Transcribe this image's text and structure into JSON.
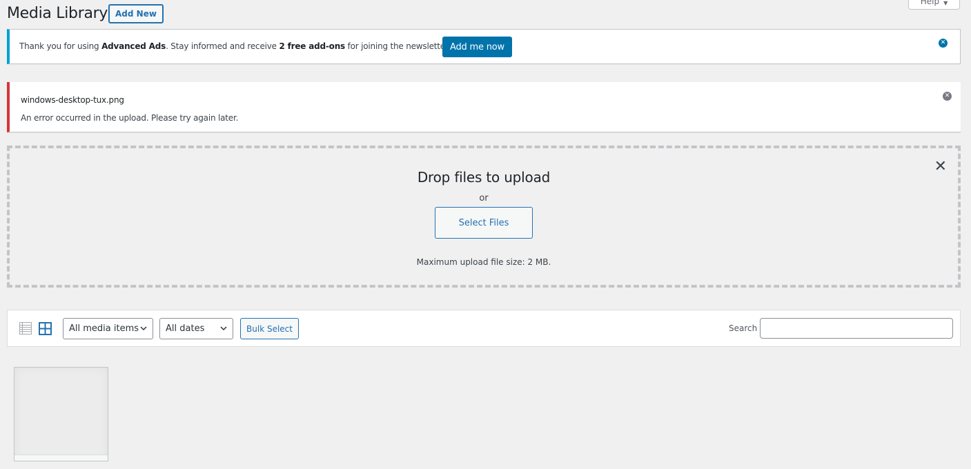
{
  "header": {
    "title": "Media Library",
    "add_new_label": "Add New",
    "help_label": "Help"
  },
  "notice_info": {
    "text_parts": [
      "Thank you for using ",
      "Advanced Ads",
      ". Stay informed and receive ",
      "2 free add-ons",
      " for joining the newsletter."
    ],
    "button_label": "Add me now",
    "accent_color": "#00a0d2"
  },
  "notice_error": {
    "filename": "windows-desktop-tux.png",
    "message": "An error occurred in the upload. Please try again later.",
    "accent_color": "#d63638"
  },
  "uploader": {
    "title": "Drop files to upload",
    "or_label": "or",
    "select_button_label": "Select Files",
    "max_size_text": "Maximum upload file size: 2 MB."
  },
  "toolbar": {
    "view_modes": [
      "list",
      "grid"
    ],
    "active_view": "grid",
    "media_type_filter": "All media items",
    "date_filter": "All dates",
    "bulk_select_label": "Bulk Select",
    "search_label": "Search",
    "search_value": ""
  },
  "media_items": [
    {
      "state": "uploading-placeholder"
    }
  ]
}
